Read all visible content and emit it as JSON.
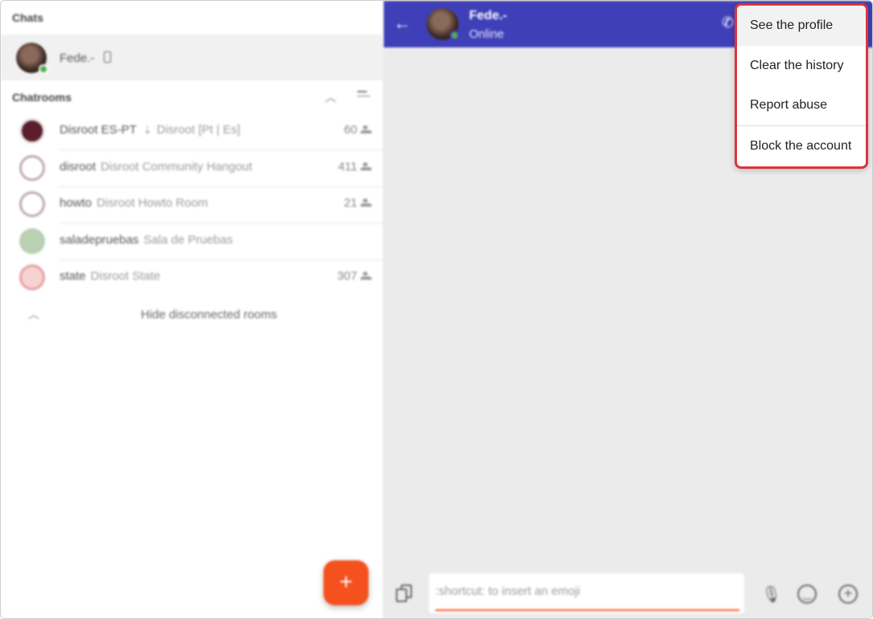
{
  "left_panel": {
    "chats_title": "Chats",
    "contact": {
      "name": "Fede.-",
      "status_color": "#4caf50"
    },
    "chatrooms_title": "Chatrooms",
    "rooms": [
      {
        "name": "Disroot ES-PT",
        "desc": "Disroot [Pt | Es]",
        "count": "60",
        "avatar_color": "#5a1f2a",
        "pinned": true
      },
      {
        "name": "disroot",
        "desc": "Disroot Community Hangout",
        "count": "411",
        "avatar_color": "#bfa9b0",
        "pinned": false
      },
      {
        "name": "howto",
        "desc": "Disroot Howto Room",
        "count": "21",
        "avatar_color": "#bfa9b0",
        "pinned": false
      },
      {
        "name": "saladepruebas",
        "desc": "Sala de Pruebas",
        "count": "",
        "avatar_color": "#b9d0b3",
        "pinned": false
      },
      {
        "name": "state",
        "desc": "Disroot State",
        "count": "307",
        "avatar_color": "#e8a0a0",
        "pinned": false
      }
    ],
    "hide_rooms_label": "Hide disconnected rooms",
    "fab_label": "+"
  },
  "header": {
    "back_icon": "arrow-left-icon",
    "name": "Fede.-",
    "status": "Online",
    "call_icon": "phone-icon",
    "bg_color": "#3f3fb8"
  },
  "composer": {
    "placeholder": ":shortcut: to insert an emoji",
    "accent_color": "#f4511e"
  },
  "menu": {
    "items": [
      "See the profile",
      "Clear the history",
      "Report abuse",
      "Block the account"
    ],
    "highlight_color": "#d9353a"
  }
}
